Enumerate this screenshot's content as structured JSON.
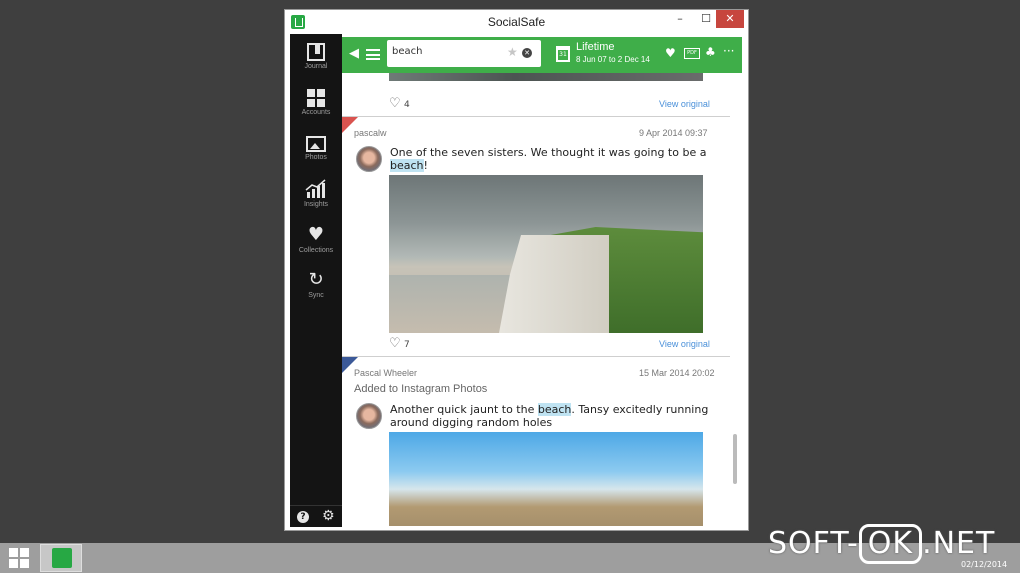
{
  "window": {
    "title": "SocialSafe",
    "min": "–",
    "max": "☐",
    "close": "✕"
  },
  "sidebar": {
    "items": [
      {
        "label": "Journal"
      },
      {
        "label": "Accounts"
      },
      {
        "label": "Photos"
      },
      {
        "label": "Insights"
      },
      {
        "label": "Collections"
      },
      {
        "label": "Sync"
      }
    ],
    "help": "?",
    "settings": "⚙"
  },
  "toolbar": {
    "search_value": "beach",
    "range_title": "Lifetime",
    "range_dates": "8 Jun 07 to 2 Dec 14",
    "calendar_num": "31",
    "pdf_label": "PDF",
    "more": "···"
  },
  "feed": {
    "top": {
      "likes": "4",
      "view_label": "View original"
    },
    "posts": [
      {
        "author": "pascalw",
        "date": "9 Apr 2014 09:37",
        "subline": "",
        "text_before": "One of the seven sisters. We  thought it was going to be a ",
        "highlight": "beach",
        "text_after": "!",
        "likes": "7",
        "view_label": "View original",
        "corner_color": "#d9534f"
      },
      {
        "author": "Pascal Wheeler",
        "date": "15 Mar 2014 20:02",
        "subline": "Added to Instagram Photos",
        "text_before": "Another quick jaunt to the ",
        "highlight": "beach",
        "text_after": ". Tansy excitedly running around digging random holes",
        "likes": "",
        "view_label": "",
        "corner_color": "#3b5998"
      }
    ]
  },
  "taskbar": {
    "watermark_left": "SOFT-",
    "watermark_ok": "OK",
    "watermark_right": ".NET",
    "date": "02/12/2014"
  },
  "colors": {
    "accent": "#3fae49",
    "sidebar": "#141414",
    "link": "#4a90d9",
    "highlight": "#bfe3f2"
  }
}
